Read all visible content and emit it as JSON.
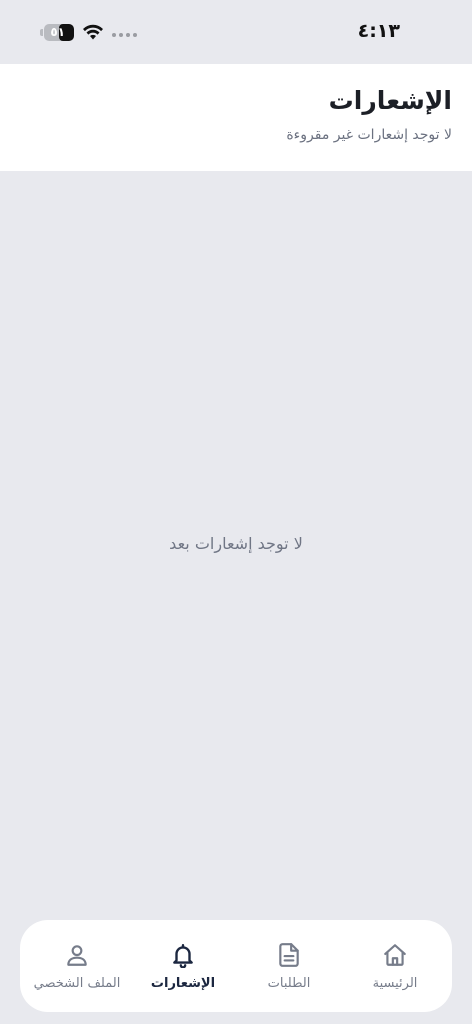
{
  "status_bar": {
    "time": "٤:١٣",
    "battery_level": "٥١",
    "battery_fraction": 0.51,
    "icons": [
      "battery-icon",
      "wifi-icon",
      "signal-dots-icon"
    ]
  },
  "header": {
    "title": "الإشعارات",
    "subtitle": "لا توجد إشعارات غير مقروءة"
  },
  "main": {
    "empty_message": "لا توجد إشعارات بعد"
  },
  "bottom_nav": {
    "items": [
      {
        "label": "الرئيسية",
        "icon": "home-icon",
        "active": false
      },
      {
        "label": "الطلبات",
        "icon": "document-icon",
        "active": false
      },
      {
        "label": "الإشعارات",
        "icon": "bell-icon",
        "active": true
      },
      {
        "label": "الملف الشخصي",
        "icon": "user-icon",
        "active": false
      }
    ]
  },
  "colors": {
    "background": "#e8e9ee",
    "surface": "#ffffff",
    "title": "#1c1f26",
    "muted_text": "#6b7180",
    "active_nav": "#1c2740",
    "inactive_nav": "#767c8a"
  }
}
